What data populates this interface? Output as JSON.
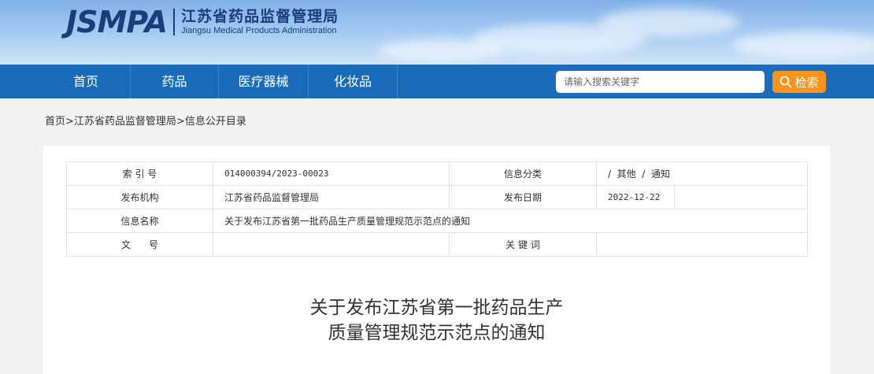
{
  "header": {
    "logo_abbr": "JSMPA",
    "org_name_cn": "江苏省药品监督管理局",
    "org_name_en": "Jiangsu Medical Products Administration"
  },
  "nav": {
    "items": [
      {
        "label": "首页"
      },
      {
        "label": "药品"
      },
      {
        "label": "医疗器械"
      },
      {
        "label": "化妆品"
      }
    ]
  },
  "search": {
    "placeholder": "请输入搜索关键字",
    "button_label": "检索"
  },
  "breadcrumb": {
    "items": [
      "首页",
      "江苏省药品监督管理局",
      "信息公开目录"
    ],
    "separator": ">"
  },
  "info_table": {
    "index_label": "索 引 号",
    "index_value": "014000394/2023-00023",
    "category_label": "信息分类",
    "category_value": "/  其他  /  通知",
    "publisher_label": "发布机构",
    "publisher_value": "江苏省药品监督管理局",
    "date_label": "发布日期",
    "date_value": "2022-12-22",
    "name_label": "信息名称",
    "name_value": "关于发布江苏省第一批药品生产质量管理规范示范点的通知",
    "docno_label": "文      号",
    "docno_value": "",
    "keywords_label": "关 键 词",
    "keywords_value": ""
  },
  "article": {
    "title_line1": "关于发布江苏省第一批药品生产",
    "title_line2": "质量管理规范示范点的通知"
  },
  "colors": {
    "nav_bg": "#1b6cb8",
    "search_button": "#f7941d",
    "logo_blue": "#1a3d7c"
  }
}
